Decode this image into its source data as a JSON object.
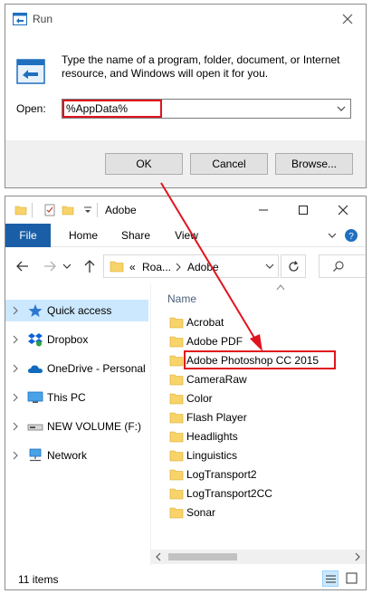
{
  "run_dialog": {
    "title": "Run",
    "description": "Type the name of a program, folder, document, or Internet resource, and Windows will open it for you.",
    "open_label": "Open:",
    "open_value": "%AppData%",
    "ok_label": "OK",
    "cancel_label": "Cancel",
    "browse_label": "Browse..."
  },
  "explorer": {
    "title": "Adobe",
    "ribbon_tabs": [
      "File",
      "Home",
      "Share",
      "View"
    ],
    "breadcrumb": {
      "overflow": "«",
      "parent": "Roa...",
      "current": "Adobe"
    },
    "nav_items": [
      {
        "label": "Quick access",
        "icon": "star-icon"
      },
      {
        "label": "Dropbox",
        "icon": "dropbox-icon"
      },
      {
        "label": "OneDrive - Personal",
        "icon": "cloud-icon"
      },
      {
        "label": "This PC",
        "icon": "computer-icon"
      },
      {
        "label": "NEW VOLUME (F:)",
        "icon": "drive-icon"
      },
      {
        "label": "Network",
        "icon": "network-icon"
      }
    ],
    "column_name": "Name",
    "folders": [
      "Acrobat",
      "Adobe PDF",
      "Adobe Photoshop CC 2015",
      "CameraRaw",
      "Color",
      "Flash Player",
      "Headlights",
      "Linguistics",
      "LogTransport2",
      "LogTransport2CC",
      "Sonar"
    ],
    "status_count": "11 items"
  },
  "colors": {
    "highlight": "#e0141e",
    "file_tab": "#1b5ea8",
    "selected": "#cce8ff",
    "folder": "#f8d36a"
  }
}
